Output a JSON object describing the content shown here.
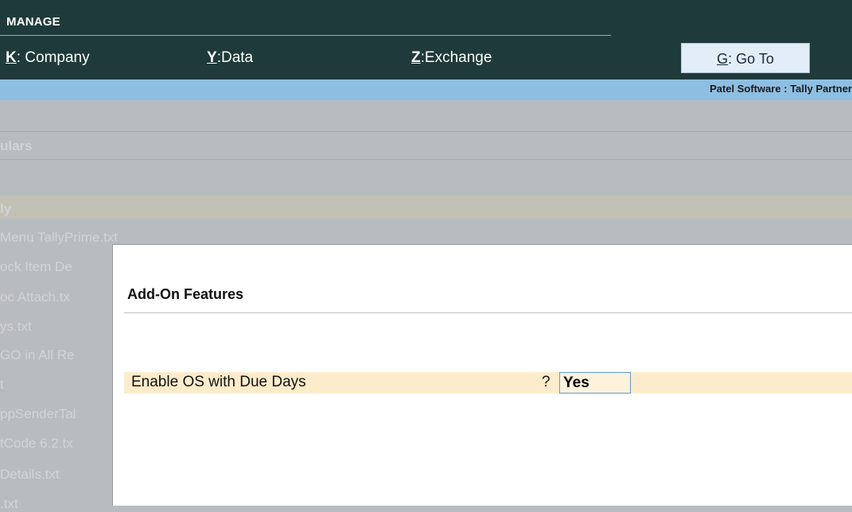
{
  "gateway": {
    "section_title": "MANAGE",
    "menu": [
      {
        "key": "K",
        "label": "Company"
      },
      {
        "key": "Y",
        "label": "Data"
      },
      {
        "key": "Z",
        "label": "Exchange"
      }
    ],
    "goto": {
      "key": "G",
      "label": "Go To"
    }
  },
  "partner_text": "Patel Software : Tally Partner",
  "background": {
    "heading": "ulars",
    "selected": "ly",
    "items": [
      "Menu TallyPrime.txt",
      "ock Item De",
      "oc Attach.tx",
      "ys.txt",
      "GO in All Re",
      "t",
      "ppSenderTal",
      "tCode 6.2.tx",
      "Details.txt",
      ".txt"
    ]
  },
  "panel": {
    "title": "Add-On Features",
    "field": {
      "label": "Enable OS with Due Days",
      "question": "?",
      "value": "Yes"
    }
  },
  "colors": {
    "topbar": "#1f3a3a",
    "bluebar": "#8dbfe3",
    "field_highlight": "#fdeccb",
    "input_border": "#5a9ad8"
  }
}
